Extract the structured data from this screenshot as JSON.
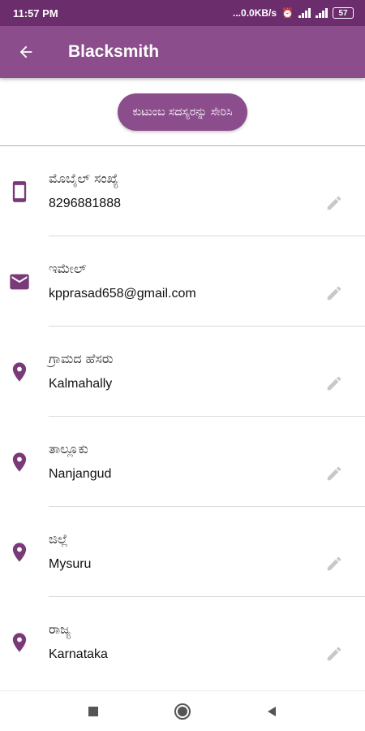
{
  "status_bar": {
    "time": "11:57 PM",
    "network_speed": "...0.0KB/s",
    "battery": "57"
  },
  "app_bar": {
    "title": "Blacksmith",
    "back_icon": "arrow-back-icon"
  },
  "add_member_button": {
    "label": "ಕುಟುಂಬ ಸದಸ್ಯರನ್ನು ಸೇರಿಸಿ"
  },
  "details": [
    {
      "label": "ಮೊಬೈಲ್ ಸಂಖ್ಯೆ",
      "value": "8296881888",
      "icon": "phone-icon"
    },
    {
      "label": "ಇಮೇಲ್",
      "value": "kpprasad658@gmail.com",
      "icon": "mail-icon"
    },
    {
      "label": "ಗ್ರಾಮದ ಹೆಸರು",
      "value": "Kalmahally",
      "icon": "location-pin-icon"
    },
    {
      "label": "ತಾಲ್ಲೂಕು",
      "value": "Nanjangud",
      "icon": "location-pin-icon"
    },
    {
      "label": "ಜಿಲ್ಲೆ",
      "value": "Mysuru",
      "icon": "location-pin-icon"
    },
    {
      "label": "ರಾಜ್ಯ",
      "value": "Karnataka",
      "icon": "location-pin-icon"
    }
  ],
  "colors": {
    "status_bar": "#6b2d6b",
    "app_bar": "#8b4d8b",
    "accent": "#7a3a7a",
    "edit_icon": "#c8c8c8"
  }
}
